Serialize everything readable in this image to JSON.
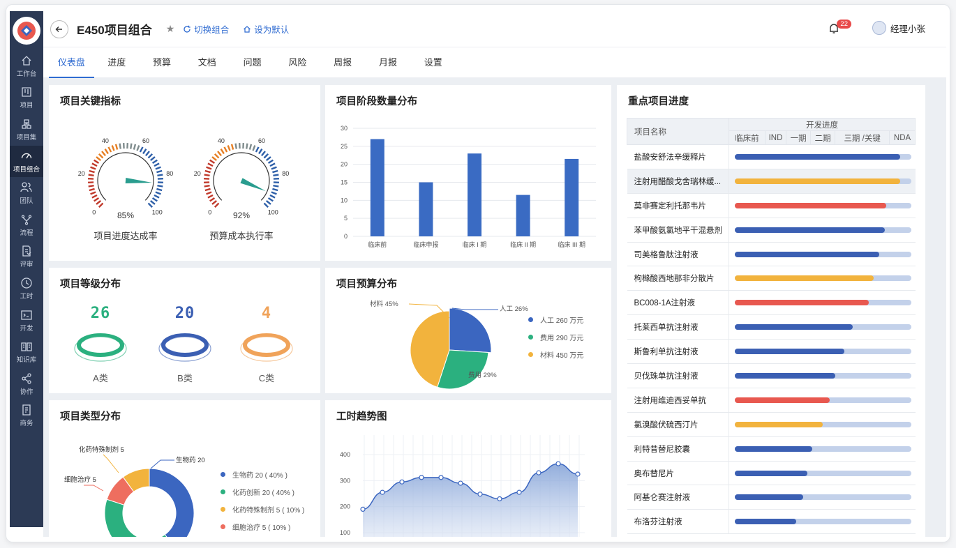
{
  "sidebar": {
    "items": [
      {
        "label": "工作台",
        "icon": "home-icon"
      },
      {
        "label": "项目",
        "icon": "board-icon"
      },
      {
        "label": "项目集",
        "icon": "hierarchy-icon"
      },
      {
        "label": "项目组合",
        "icon": "gauge-icon"
      },
      {
        "label": "团队",
        "icon": "team-icon"
      },
      {
        "label": "流程",
        "icon": "flow-icon"
      },
      {
        "label": "评审",
        "icon": "review-icon"
      },
      {
        "label": "工时",
        "icon": "clock-icon"
      },
      {
        "label": "开发",
        "icon": "terminal-icon"
      },
      {
        "label": "知识库",
        "icon": "book-icon"
      },
      {
        "label": "协作",
        "icon": "share-icon"
      },
      {
        "label": "商务",
        "icon": "contract-icon"
      }
    ],
    "active_index": 3
  },
  "header": {
    "title": "E450项目组合",
    "switch_label": "切换组合",
    "default_label": "设为默认",
    "notification_count": "22",
    "user_name": "经理小张"
  },
  "tabs": [
    "仪表盘",
    "进度",
    "预算",
    "文档",
    "问题",
    "风险",
    "周报",
    "月报",
    "设置"
  ],
  "active_tab": 0,
  "kpi": {
    "title": "项目关键指标",
    "gauges": [
      {
        "label": "项目进度达成率",
        "value": "85%",
        "pct": 0.85
      },
      {
        "label": "预算成本执行率",
        "value": "92%",
        "pct": 0.92
      }
    ],
    "ticks": [
      "0",
      "20",
      "40",
      "60",
      "80",
      "100"
    ]
  },
  "stage": {
    "title": "项目阶段数量分布",
    "chart_data": {
      "type": "bar",
      "categories": [
        "临床前",
        "临床申报",
        "临床 I 期",
        "临床 II 期",
        "临床 III 期"
      ],
      "values": [
        27,
        15,
        23,
        11.5,
        21.5
      ],
      "ylim": [
        0,
        30
      ],
      "yticks": [
        "0",
        "5",
        "10",
        "15",
        "20",
        "25",
        "30"
      ],
      "color": "#3a6bc3"
    }
  },
  "level": {
    "title": "项目等级分布",
    "items": [
      {
        "value": "26",
        "label": "A类",
        "color": "#2bb07f"
      },
      {
        "value": "20",
        "label": "B类",
        "color": "#3b5fb3"
      },
      {
        "value": "4",
        "label": "C类",
        "color": "#f0a35a"
      }
    ]
  },
  "budget": {
    "title": "项目预算分布",
    "chart_data": {
      "type": "pie",
      "slices": [
        {
          "name": "人工",
          "pct": 26,
          "label": "人工 26%",
          "color": "#3b66c0"
        },
        {
          "name": "费用",
          "pct": 29,
          "label": "费用 29%",
          "color": "#2bb07f"
        },
        {
          "name": "材料",
          "pct": 45,
          "label": "材料 45%",
          "color": "#f2b33d"
        }
      ]
    },
    "legend": [
      {
        "text": "人工  260 万元",
        "color": "#3b66c0"
      },
      {
        "text": "费用  290 万元",
        "color": "#2bb07f"
      },
      {
        "text": "材料  450 万元",
        "color": "#f2b33d"
      }
    ]
  },
  "type": {
    "title": "项目类型分布",
    "chart_data": {
      "type": "pie",
      "slices": [
        {
          "name": "生物药",
          "value": 20,
          "pct": 40,
          "label": "生物药 20",
          "color": "#3b66c0"
        },
        {
          "name": "化药创新",
          "value": 20,
          "pct": 40,
          "label": "",
          "color": "#2bb07f"
        },
        {
          "name": "细胞治疗",
          "value": 5,
          "pct": 10,
          "label": "细胞治疗 5",
          "color": "#ee6e5f"
        },
        {
          "name": "化药特殊制剂",
          "value": 5,
          "pct": 10,
          "label": "化药特殊制剂 5",
          "color": "#f2b33d"
        }
      ]
    },
    "legend": [
      {
        "text": "生物药  20 ( 40% )",
        "color": "#3b66c0"
      },
      {
        "text": "化药创新  20 ( 40% )",
        "color": "#2bb07f"
      },
      {
        "text": "化药特殊制剂  5  ( 10% )",
        "color": "#f2b33d"
      },
      {
        "text": "细胞治疗  5  ( 10% )",
        "color": "#ee6e5f"
      }
    ]
  },
  "hours": {
    "title": "工时趋势图",
    "chart_data": {
      "type": "area",
      "values": [
        190,
        255,
        295,
        312,
        312,
        290,
        248,
        230,
        255,
        330,
        365,
        325
      ],
      "ylim": [
        80,
        420
      ],
      "yticks": [
        "100",
        "200",
        "300",
        "400"
      ],
      "color": "#3b66c0"
    }
  },
  "progress": {
    "title": "重点项目进度",
    "header_name": "项目名称",
    "header_group": "开发进度",
    "stages": [
      "临床前",
      "IND",
      "一期",
      "二期",
      "三期 /关键",
      "NDA"
    ],
    "rows": [
      {
        "name": "盐酸安舒法辛缓释片",
        "pct": 0.94,
        "color": "#3b5fb3"
      },
      {
        "name": "注射用醋酸戈舍瑞林缓...",
        "pct": 0.94,
        "color": "#f2b33d"
      },
      {
        "name": "莫非赛定利托那韦片",
        "pct": 0.86,
        "color": "#e8584f"
      },
      {
        "name": "苯甲酸氨氯地平干混悬剂",
        "pct": 0.85,
        "color": "#3b5fb3"
      },
      {
        "name": "司美格鲁肽注射液",
        "pct": 0.82,
        "color": "#3b5fb3"
      },
      {
        "name": "枸橼酸西地那非分散片",
        "pct": 0.79,
        "color": "#f2b33d"
      },
      {
        "name": "BC008-1A注射液",
        "pct": 0.76,
        "color": "#e8584f"
      },
      {
        "name": "托莱西单抗注射液",
        "pct": 0.67,
        "color": "#3b5fb3"
      },
      {
        "name": "斯鲁利单抗注射液",
        "pct": 0.62,
        "color": "#3b5fb3"
      },
      {
        "name": "贝伐珠单抗注射液",
        "pct": 0.57,
        "color": "#3b5fb3"
      },
      {
        "name": "注射用维迪西妥单抗",
        "pct": 0.54,
        "color": "#e8584f"
      },
      {
        "name": "氯溴酸伏硫西汀片",
        "pct": 0.5,
        "color": "#f2b33d"
      },
      {
        "name": "利特昔替尼胶囊",
        "pct": 0.44,
        "color": "#3b5fb3"
      },
      {
        "name": "奥布替尼片",
        "pct": 0.41,
        "color": "#3b5fb3"
      },
      {
        "name": "阿基仑赛注射液",
        "pct": 0.39,
        "color": "#3b5fb3"
      },
      {
        "name": "布洛芬注射液",
        "pct": 0.35,
        "color": "#3b5fb3"
      }
    ]
  }
}
